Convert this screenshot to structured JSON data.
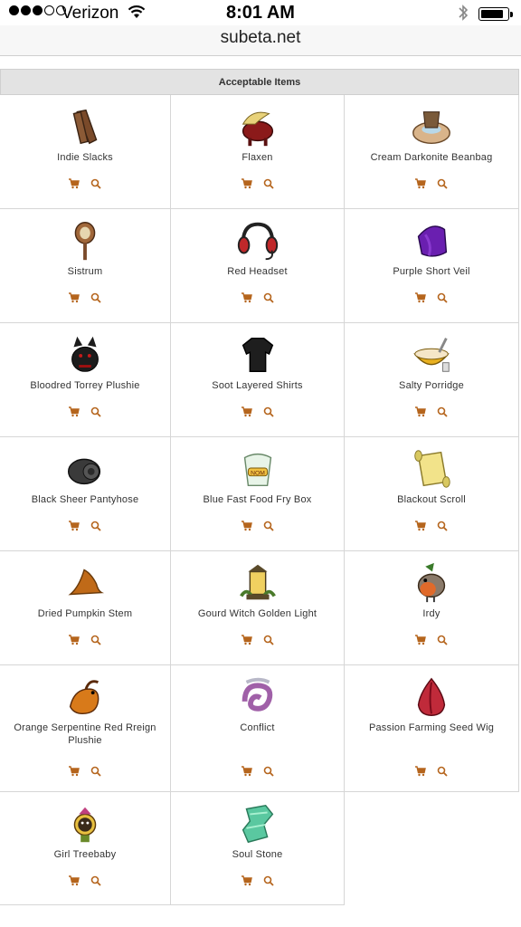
{
  "statusbar": {
    "carrier": "Verizon",
    "time": "8:01 AM",
    "signal_bars": 3,
    "signal_total": 5,
    "battery_level": 0.8
  },
  "browser": {
    "url": "subeta.net"
  },
  "table": {
    "header": "Acceptable Items",
    "accent_color": "#b5651d",
    "items": [
      {
        "name": "Indie Slacks",
        "icon": "brown-slacks-icon"
      },
      {
        "name": "Flaxen",
        "icon": "red-horse-pet-icon"
      },
      {
        "name": "Cream Darkonite Beanbag",
        "icon": "beanbag-icon"
      },
      {
        "name": "Sistrum",
        "icon": "sistrum-rattle-icon"
      },
      {
        "name": "Red Headset",
        "icon": "headset-icon"
      },
      {
        "name": "Purple Short Veil",
        "icon": "purple-veil-icon"
      },
      {
        "name": "Bloodred Torrey Plushie",
        "icon": "black-plushie-icon"
      },
      {
        "name": "Soot Layered Shirts",
        "icon": "black-shirt-icon"
      },
      {
        "name": "Salty Porridge",
        "icon": "porridge-bowl-icon"
      },
      {
        "name": "Black Sheer Pantyhose",
        "icon": "pantyhose-roll-icon"
      },
      {
        "name": "Blue Fast Food Fry Box",
        "icon": "fry-box-icon"
      },
      {
        "name": "Blackout Scroll",
        "icon": "scroll-icon"
      },
      {
        "name": "Dried Pumpkin Stem",
        "icon": "pumpkin-stem-icon"
      },
      {
        "name": "Gourd Witch Golden Light",
        "icon": "lantern-icon"
      },
      {
        "name": "Irdy",
        "icon": "robin-bird-icon"
      },
      {
        "name": "Orange Serpentine Red Rreign Plushie",
        "icon": "orange-dragon-plushie-icon"
      },
      {
        "name": "Conflict",
        "icon": "swirl-creature-icon"
      },
      {
        "name": "Passion Farming Seed Wig",
        "icon": "red-seed-wig-icon"
      },
      {
        "name": "Girl Treebaby",
        "icon": "treebaby-icon"
      },
      {
        "name": "Soul Stone",
        "icon": "green-crystal-icon"
      }
    ]
  }
}
